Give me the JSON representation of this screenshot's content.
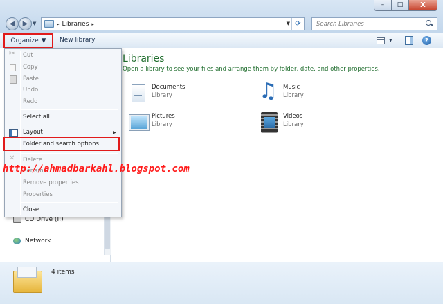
{
  "window": {
    "min_glyph": "–",
    "max_glyph": "□",
    "close_glyph": "X"
  },
  "address": {
    "path_root_glyph": "▸",
    "location": "Libraries",
    "trailing_glyph": "▸"
  },
  "search": {
    "placeholder": "Search Libraries"
  },
  "toolbar": {
    "organize_label": "Organize",
    "new_library_label": "New library"
  },
  "organize_menu": {
    "items": [
      {
        "label": "Cut",
        "enabled": false,
        "icon": "scissors-icon"
      },
      {
        "label": "Copy",
        "enabled": false,
        "icon": "copy-icon"
      },
      {
        "label": "Paste",
        "enabled": false,
        "icon": "paste-icon"
      },
      {
        "label": "Undo",
        "enabled": false
      },
      {
        "label": "Redo",
        "enabled": false
      },
      {
        "label": "Select all",
        "enabled": true
      },
      {
        "label": "Layout",
        "enabled": true,
        "icon": "layout-icon",
        "submenu": true
      },
      {
        "label": "Folder and search options",
        "enabled": true,
        "highlighted": true
      },
      {
        "label": "Delete",
        "enabled": false,
        "icon": "delete-icon"
      },
      {
        "label": "Rename",
        "enabled": false
      },
      {
        "label": "Remove properties",
        "enabled": false
      },
      {
        "label": "Properties",
        "enabled": false
      },
      {
        "label": "Close",
        "enabled": true
      }
    ],
    "highlight_color": "#e11b1b"
  },
  "nav_pane": {
    "items": [
      {
        "label": "CD Drive (I:)",
        "icon": "cd-drive-icon"
      },
      {
        "label": "Network",
        "icon": "network-icon"
      }
    ]
  },
  "main": {
    "title": "Libraries",
    "description": "Open a library to see your files and arrange them by folder, date, and other properties.",
    "libraries": [
      {
        "name": "Documents",
        "type": "Library",
        "icon": "documents-library-icon"
      },
      {
        "name": "Music",
        "type": "Library",
        "icon": "music-library-icon"
      },
      {
        "name": "Pictures",
        "type": "Library",
        "icon": "pictures-library-icon"
      },
      {
        "name": "Videos",
        "type": "Library",
        "icon": "videos-library-icon"
      }
    ]
  },
  "details": {
    "count": "4 items"
  },
  "watermark": "http://ahmadbarkahl.blogspot.com"
}
